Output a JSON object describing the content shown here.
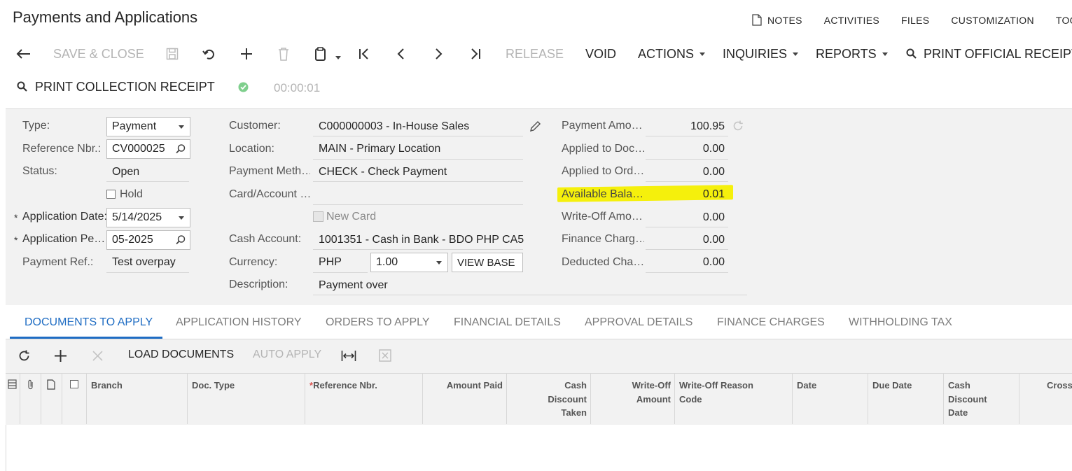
{
  "page": {
    "title": "Payments and Applications"
  },
  "top_links": {
    "notes": "NOTES",
    "activities": "ACTIVITIES",
    "files": "FILES",
    "customization": "CUSTOMIZATION",
    "tools": "TOO"
  },
  "toolbar": {
    "save_close": "SAVE & CLOSE",
    "release": "RELEASE",
    "void": "VOID",
    "actions": "ACTIONS",
    "inquiries": "INQUIRIES",
    "reports": "REPORTS",
    "print_official": "PRINT OFFICIAL RECEIPT",
    "print_collection": "PRINT COLLECTION RECEIPT",
    "timer": "00:00:01"
  },
  "form": {
    "type_label": "Type:",
    "type_value": "Payment",
    "refnbr_label": "Reference Nbr.:",
    "refnbr_value": "CV000025",
    "status_label": "Status:",
    "status_value": "Open",
    "hold_label": "Hold",
    "appdate_label": "Application Date:",
    "appdate_value": "5/14/2025",
    "appperiod_label": "Application Pe…",
    "appperiod_value": "05-2025",
    "payref_label": "Payment Ref.:",
    "payref_value": "Test overpay",
    "customer_label": "Customer:",
    "customer_value": "C000000003 - In-House Sales",
    "location_label": "Location:",
    "location_value": "MAIN - Primary Location",
    "paymethod_label": "Payment Meth…",
    "paymethod_value": "CHECK - Check Payment",
    "card_label": "Card/Account …",
    "newcard_label": "New Card",
    "cashacct_label": "Cash Account:",
    "cashacct_value": "1001351 - Cash in Bank - BDO PHP CA5",
    "currency_label": "Currency:",
    "currency_value": "PHP",
    "rate_value": "1.00",
    "viewbase_label": "VIEW BASE",
    "description_label": "Description:",
    "description_value": "Payment over"
  },
  "amounts": {
    "payment_label": "Payment Amo…",
    "payment_value": "100.95",
    "applied_doc_label": "Applied to Doc…",
    "applied_doc_value": "0.00",
    "applied_ord_label": "Applied to Ord…",
    "applied_ord_value": "0.00",
    "available_label": "Available Bala…",
    "available_value": "0.01",
    "writeoff_label": "Write-Off Amo…",
    "writeoff_value": "0.00",
    "finance_label": "Finance Charg…",
    "finance_value": "0.00",
    "deducted_label": "Deducted Cha…",
    "deducted_value": "0.00"
  },
  "tabs": {
    "docs_to_apply": "DOCUMENTS TO APPLY",
    "app_history": "APPLICATION HISTORY",
    "orders_to_apply": "ORDERS TO APPLY",
    "financial": "FINANCIAL DETAILS",
    "approval": "APPROVAL DETAILS",
    "finance_charges": "FINANCE CHARGES",
    "withholding": "WITHHOLDING TAX"
  },
  "grid_toolbar": {
    "load_docs": "LOAD DOCUMENTS",
    "auto_apply": "AUTO APPLY"
  },
  "grid_columns": {
    "branch": "Branch",
    "doc_type": "Doc. Type",
    "ref_nbr": "Reference Nbr.",
    "amount_paid": "Amount Paid",
    "cash_disc_taken_1": "Cash",
    "cash_disc_taken_2": "Discount",
    "cash_disc_taken_3": "Taken",
    "wo_amount_1": "Write-Off",
    "wo_amount_2": "Amount",
    "wo_reason_1": "Write-Off Reason",
    "wo_reason_2": "Code",
    "date": "Date",
    "due_date": "Due Date",
    "cash_disc_date_1": "Cash",
    "cash_disc_date_2": "Discount",
    "cash_disc_date_3": "Date",
    "cross": "Cross"
  },
  "colors": {
    "accent": "#1e6cc3",
    "highlight": "#f5f00c",
    "panel": "#f2f2f2",
    "disabled": "#b4b4b4",
    "success": "#7fcf8d"
  }
}
